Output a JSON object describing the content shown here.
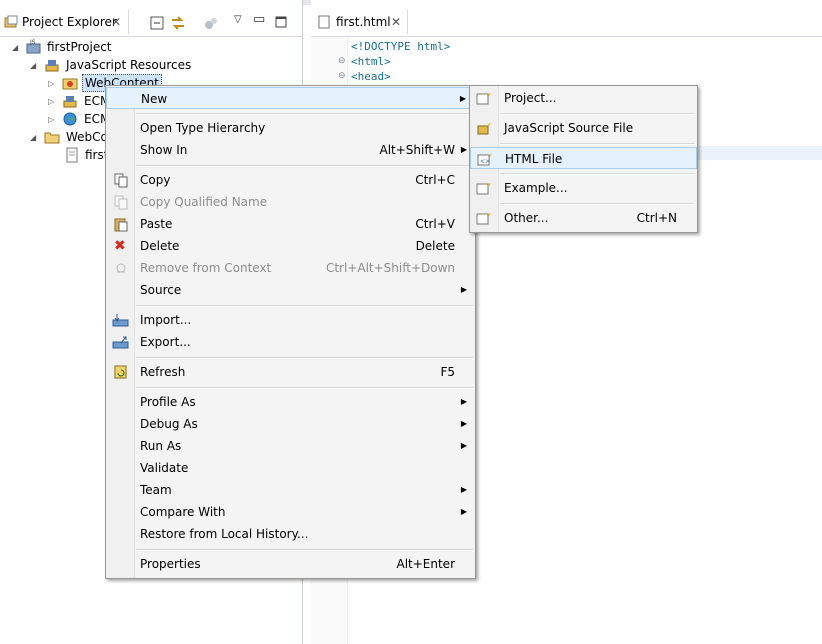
{
  "explorer": {
    "tab_title": "Project Explorer",
    "tree": {
      "project": "firstProject",
      "js_resources": "JavaScript Resources",
      "web_content_sel": "WebContent",
      "ecma1": "ECM",
      "ecma2": "ECM",
      "web_content": "WebCo",
      "first": "first"
    }
  },
  "editor": {
    "tab_title": "first.html",
    "lines": [
      "<!DOCTYPE html>",
      "<html>",
      "<head>"
    ]
  },
  "context_menu": {
    "new": "New",
    "open_type_hierarchy": "Open Type Hierarchy",
    "show_in": "Show In",
    "show_in_sc": "Alt+Shift+W",
    "copy": "Copy",
    "copy_sc": "Ctrl+C",
    "copy_qualified": "Copy Qualified Name",
    "paste": "Paste",
    "paste_sc": "Ctrl+V",
    "delete": "Delete",
    "delete_sc": "Delete",
    "remove_ctx": "Remove from Context",
    "remove_ctx_sc": "Ctrl+Alt+Shift+Down",
    "source": "Source",
    "import": "Import...",
    "export": "Export...",
    "refresh": "Refresh",
    "refresh_sc": "F5",
    "profile_as": "Profile As",
    "debug_as": "Debug As",
    "run_as": "Run As",
    "validate": "Validate",
    "team": "Team",
    "compare_with": "Compare With",
    "restore_history": "Restore from Local History...",
    "properties": "Properties",
    "properties_sc": "Alt+Enter"
  },
  "submenu": {
    "project": "Project...",
    "js_source": "JavaScript Source File",
    "html_file": "HTML File",
    "example": "Example...",
    "other": "Other...",
    "other_sc": "Ctrl+N"
  },
  "colors": {
    "accent": "#3a6ea5",
    "highlight": "#e5f1fb"
  }
}
